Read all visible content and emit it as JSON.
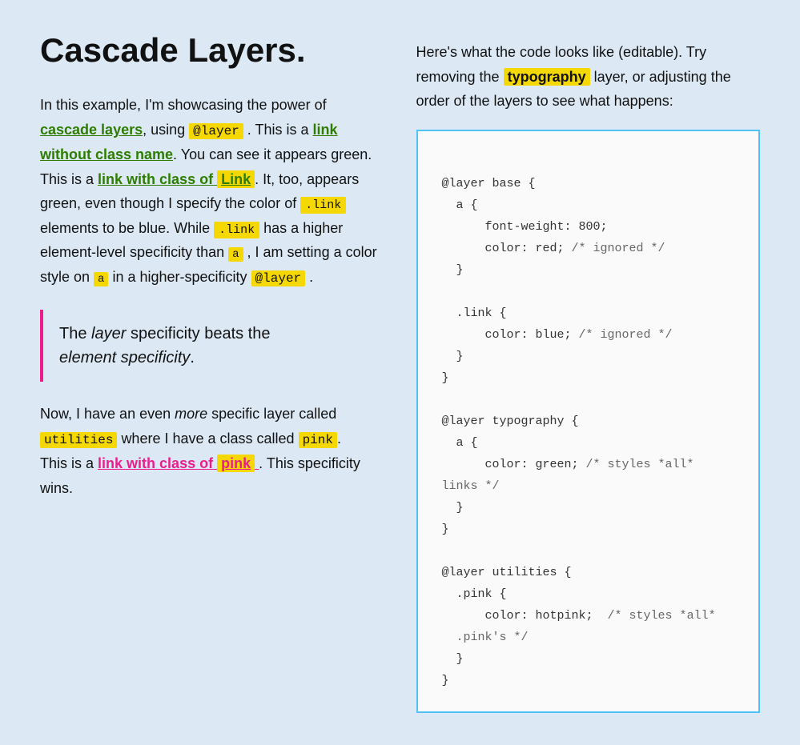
{
  "title": "Cascade Layers.",
  "left": {
    "intro": "In this example, I'm showcasing the power of",
    "cascade_layers_link": "cascade layers",
    "using_text": ", using",
    "at_layer_code": "@layer",
    "is_text": ". This is a",
    "link_no_class": "link without class name",
    "see_text": ". You can see it appears green. This is a",
    "link_with_class": "link with class of",
    "link_class_code": "Link",
    "it_too": ". It, too, appears green, even though I specify the color of",
    "link_code_1": ".link",
    "elements_blue": "elements to be blue. While",
    "link_code_2": ".link",
    "higher_spec": "has a higher element-level specificity than",
    "a_code": "a",
    "iam_text": ", I am setting a color style on",
    "a_code2": "a",
    "higher_layer": "in a higher-specificity",
    "layer_code": "@layer",
    "period": ".",
    "blockquote_line1": "The",
    "blockquote_em1": "layer",
    "blockquote_line1b": "specificity beats the",
    "blockquote_line2": "element specificity",
    "blockquote_period": ".",
    "now_text": "Now, I have an even",
    "more_em": "more",
    "specific_text": "specific layer called",
    "utilities_code": "utilities",
    "where_text": "where I have a class called",
    "pink_code": "pink",
    "period2": ".",
    "this_is_a": "This is a",
    "link_pink": "link with class of",
    "pink_highlight": "pink",
    "this_spec": ". This specificity wins."
  },
  "right": {
    "description_1": "Here's what the code looks like (editable). Try removing the",
    "typography_code": "typography",
    "description_2": "layer, or adjusting the order of the layers to see what happens:",
    "code": "@layer base {\n  a {\n      font-weight: 800;\n      color: red; /* ignored */\n  }\n\n  .link {\n      color: blue; /* ignored */\n  }\n}\n\n@layer typography {\n  a {\n      color: green; /* styles *all*\nlinks */\n  }\n}\n\n@layer utilities {\n  .pink {\n      color: hotpink;  /* styles *all*\n  .pink's */\n  }\n}"
  }
}
